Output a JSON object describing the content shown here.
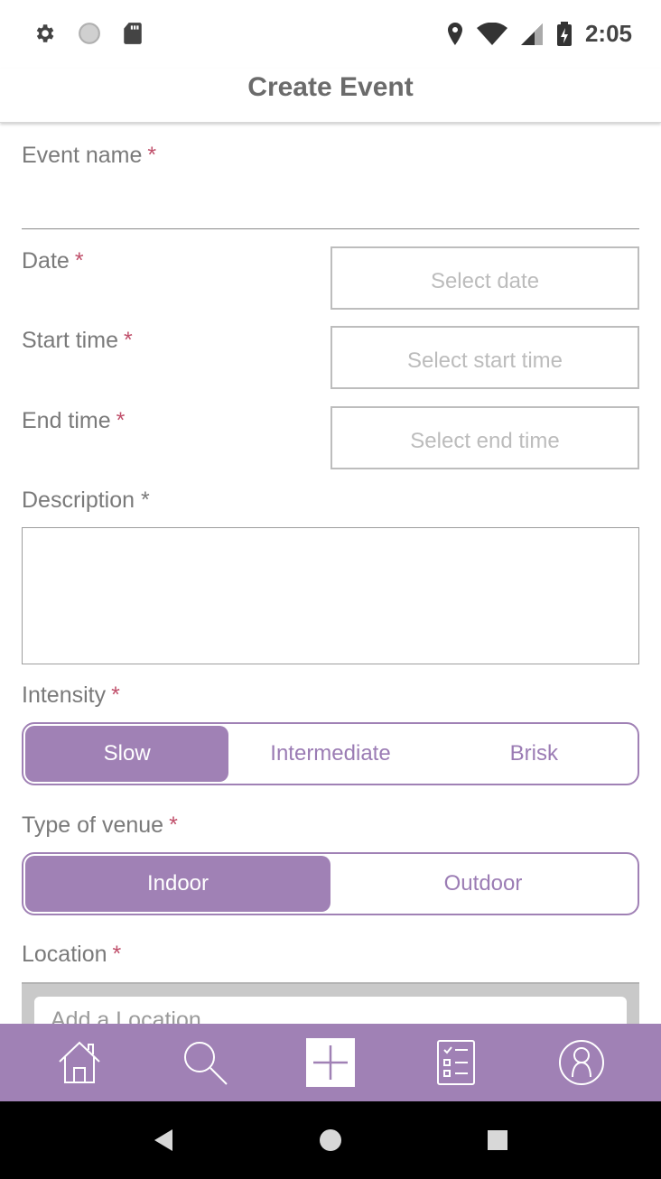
{
  "status_bar": {
    "time": "2:05",
    "icons_left": [
      "gear-icon",
      "circle-icon",
      "sd-card-icon"
    ],
    "icons_right": [
      "location-pin-icon",
      "wifi-icon",
      "signal-icon",
      "battery-charging-icon"
    ]
  },
  "app_bar": {
    "title": "Create Event"
  },
  "form": {
    "event_name": {
      "label": "Event name",
      "required": "*"
    },
    "date": {
      "label": "Date",
      "required": "*",
      "placeholder": "Select date"
    },
    "start_time": {
      "label": "Start time",
      "required": "*",
      "placeholder": "Select start time"
    },
    "end_time": {
      "label": "End time",
      "required": "*",
      "placeholder": "Select end time"
    },
    "description": {
      "label": "Description *"
    },
    "intensity": {
      "label": "Intensity",
      "required": "*",
      "options": [
        "Slow",
        "Intermediate",
        "Brisk"
      ],
      "selected": "Slow"
    },
    "venue": {
      "label": "Type of venue",
      "required": "*",
      "options": [
        "Indoor",
        "Outdoor"
      ],
      "selected": "Indoor"
    },
    "location": {
      "label": "Location",
      "required": "*",
      "placeholder": "Add a Location"
    }
  },
  "bottom_nav": {
    "items": [
      "home-icon",
      "search-icon",
      "add-icon",
      "checklist-icon",
      "profile-icon"
    ]
  },
  "colors": {
    "accent": "#a081b5",
    "required": "#c0506b"
  }
}
